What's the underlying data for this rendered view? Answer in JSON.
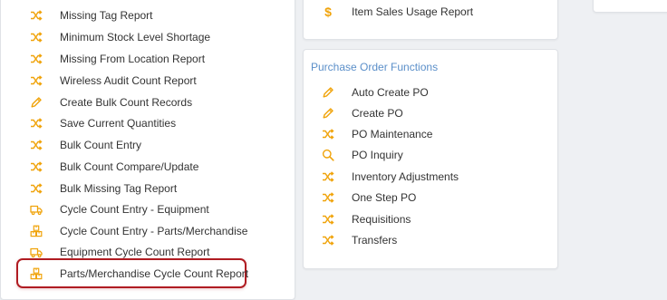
{
  "colors": {
    "accent": "#f0a30a",
    "title": "#5b8fc9",
    "highlight": "#b01c22"
  },
  "left_list": [
    {
      "label": "Missing Tag Report",
      "icon": "shuffle-icon"
    },
    {
      "label": "Minimum Stock Level Shortage",
      "icon": "shuffle-icon"
    },
    {
      "label": "Missing From Location Report",
      "icon": "shuffle-icon"
    },
    {
      "label": "Wireless Audit Count Report",
      "icon": "shuffle-icon"
    },
    {
      "label": "Create Bulk Count Records",
      "icon": "pencil-icon"
    },
    {
      "label": "Save Current Quantities",
      "icon": "shuffle-icon"
    },
    {
      "label": "Bulk Count Entry",
      "icon": "shuffle-icon"
    },
    {
      "label": "Bulk Count Compare/Update",
      "icon": "shuffle-icon"
    },
    {
      "label": "Bulk Missing Tag Report",
      "icon": "shuffle-icon"
    },
    {
      "label": "Cycle Count Entry - Equipment",
      "icon": "truck-icon"
    },
    {
      "label": "Cycle Count Entry - Parts/Merchandise",
      "icon": "boxes-icon"
    },
    {
      "label": "Equipment Cycle Count Report",
      "icon": "truck-icon"
    },
    {
      "label": "Parts/Merchandise Cycle Count Report",
      "icon": "boxes-icon"
    }
  ],
  "sales": {
    "label": "Item Sales Usage Report",
    "icon": "dollar-icon",
    "symbol": "$"
  },
  "po": {
    "title": "Purchase Order Functions",
    "items": [
      {
        "label": "Auto Create PO",
        "icon": "pencil-icon"
      },
      {
        "label": "Create PO",
        "icon": "pencil-icon"
      },
      {
        "label": "PO Maintenance",
        "icon": "shuffle-icon"
      },
      {
        "label": "PO Inquiry",
        "icon": "search-icon"
      },
      {
        "label": "Inventory Adjustments",
        "icon": "shuffle-icon"
      },
      {
        "label": "One Step PO",
        "icon": "shuffle-icon"
      },
      {
        "label": "Requisitions",
        "icon": "shuffle-icon"
      },
      {
        "label": "Transfers",
        "icon": "shuffle-icon"
      }
    ]
  }
}
